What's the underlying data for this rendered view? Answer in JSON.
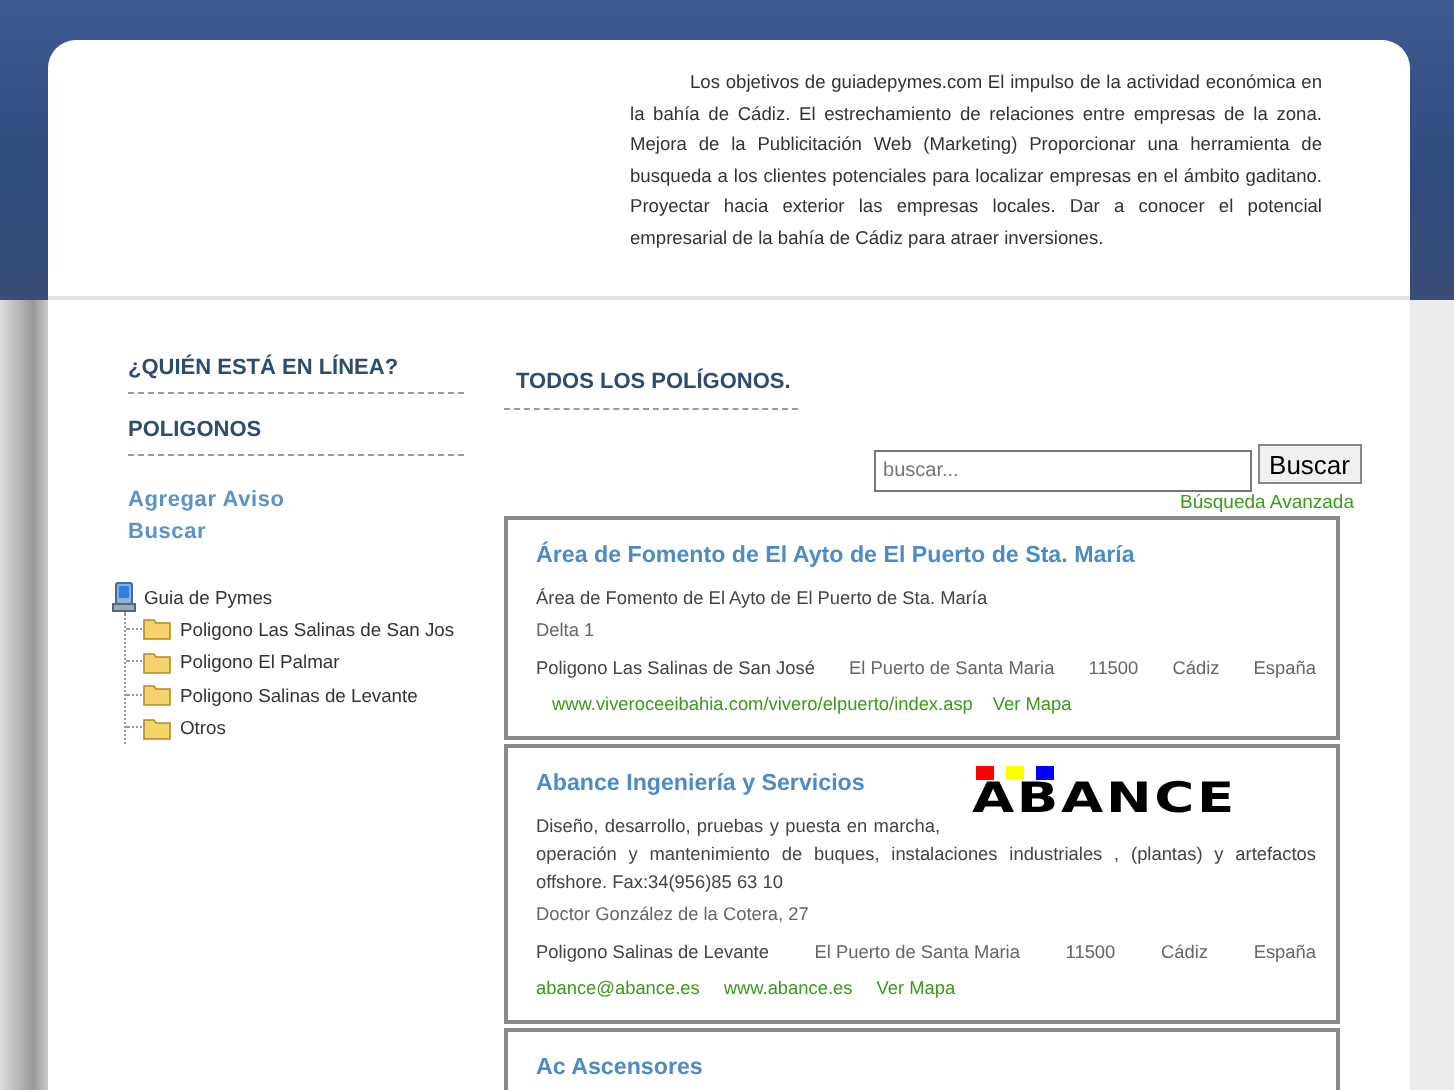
{
  "header": {
    "intro": "Los objetivos de guiadepymes.com El impulso de la actividad económica en la bahía de Cádiz. El estrechamiento de relaciones entre empresas de la zona. Mejora de la Publicitación Web (Marketing) Proporcionar una herramienta de busqueda a los clientes potenciales para localizar empresas en el ámbito gaditano. Proyectar hacia exterior las empresas locales. Dar a conocer el potencial empresarial de la bahía de Cádiz para atraer inversiones."
  },
  "sidebar": {
    "headings": [
      "¿QUIÉN ESTÁ EN LÍNEA?",
      "POLIGONOS"
    ],
    "links": [
      "Agregar Aviso",
      "Buscar"
    ],
    "tree": {
      "label": "Guia de Pymes",
      "children": [
        {
          "label": "Poligono Las Salinas de San Jos"
        },
        {
          "label": "Poligono El Palmar"
        },
        {
          "label": "Poligono Salinas de Levante"
        },
        {
          "label": "Otros"
        }
      ]
    }
  },
  "main": {
    "heading": "TODOS LOS POLÍGONOS.",
    "search": {
      "placeholder": "buscar...",
      "button": "Buscar",
      "advanced": "Búsqueda Avanzada"
    },
    "listings": [
      {
        "title": "Área de Fomento de El Ayto de El Puerto de Sta. María",
        "description": "Área de Fomento de El Ayto de El Puerto de Sta. María",
        "address": "Delta 1",
        "location": [
          "Poligono Las Salinas de San José",
          "El Puerto de Santa Maria",
          "11500",
          "Cádiz",
          "España"
        ],
        "links": [
          "www.viveroceeibahia.com/vivero/elpuerto/index.asp",
          "Ver Mapa"
        ]
      },
      {
        "title": "Abance Ingeniería y Servicios",
        "logo": "ABANCE",
        "description": "Diseño, desarrollo, pruebas y puesta en marcha, operación y mantenimiento de buques, instalaciones industriales , (plantas) y artefactos offshore. Fax:34(956)85 63 10",
        "address": "Doctor González de la Cotera, 27",
        "location": [
          "Poligono Salinas de Levante",
          "El Puerto de Santa Maria",
          "11500",
          "Cádiz",
          "España"
        ],
        "links": [
          "abance@abance.es",
          "www.abance.es",
          "Ver Mapa"
        ]
      },
      {
        "title": "Ac Ascensores"
      }
    ]
  }
}
